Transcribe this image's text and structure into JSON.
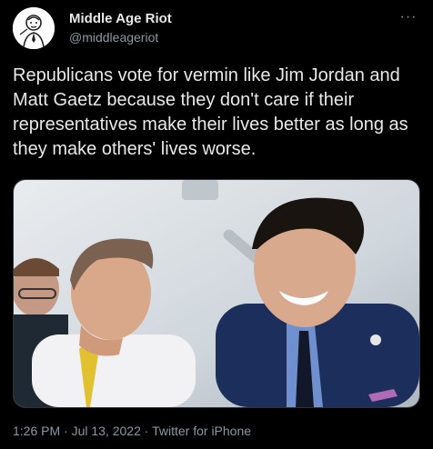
{
  "author": {
    "name": "Middle Age Riot",
    "handle": "@middleageriot"
  },
  "more_menu_label": "···",
  "tweet_text": "Republicans vote for vermin like Jim Jordan and Matt Gaetz because they don't care if their representatives make their lives better as long as they make others' lives worse.",
  "media": {
    "icon": "photo"
  },
  "meta": {
    "time": "1:26 PM",
    "separator": "·",
    "date": "Jul 13, 2022",
    "source": "Twitter for iPhone"
  },
  "colors": {
    "background": "#000000",
    "text": "#e7e9ea",
    "secondary": "#8b98a5"
  }
}
